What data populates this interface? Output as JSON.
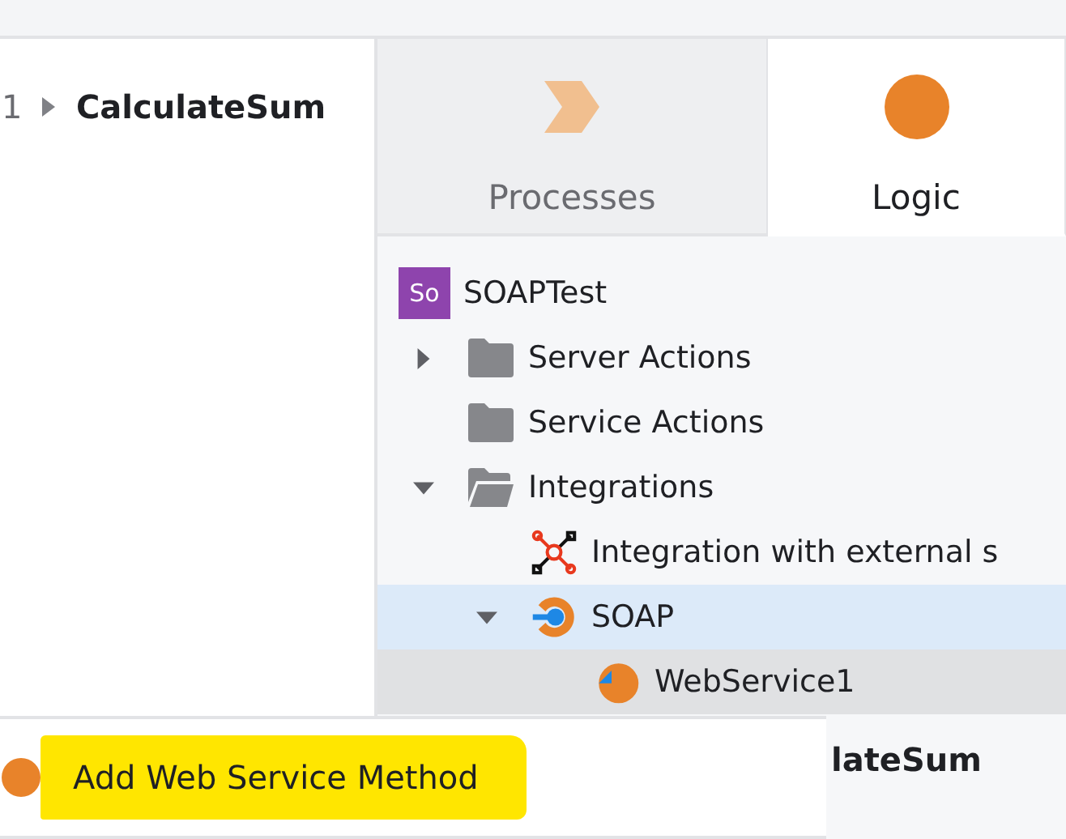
{
  "left_panel": {
    "line_number": "1",
    "item": {
      "label": "CalculateSum",
      "expanded": false
    }
  },
  "tabs": [
    {
      "label": "Processes",
      "kind": "processes",
      "selected": false
    },
    {
      "label": "Logic",
      "kind": "logic",
      "selected": true
    }
  ],
  "tree": {
    "label": "SOAPTest",
    "badge": "So",
    "children": [
      {
        "label": "Server Actions",
        "kind": "folder",
        "expanded": false,
        "selected": false,
        "hovered": false
      },
      {
        "label": "Service Actions",
        "kind": "folder",
        "selected": false,
        "hovered": false
      },
      {
        "label": "Integrations",
        "kind": "folder",
        "expanded": true,
        "selected": false,
        "hovered": false,
        "children": [
          {
            "label": "Integration with external s",
            "kind": "integration",
            "selected": false,
            "hovered": false
          },
          {
            "label": "SOAP",
            "kind": "soap",
            "expanded": true,
            "selected": false,
            "hovered": true,
            "children": [
              {
                "label": "WebService1",
                "kind": "webservice",
                "selected": true,
                "hovered": false
              }
            ]
          }
        ]
      }
    ]
  },
  "behind_text": "lateSum",
  "context_menu": {
    "items": [
      {
        "label": "Add Web Service Method",
        "highlighted": true
      }
    ]
  }
}
